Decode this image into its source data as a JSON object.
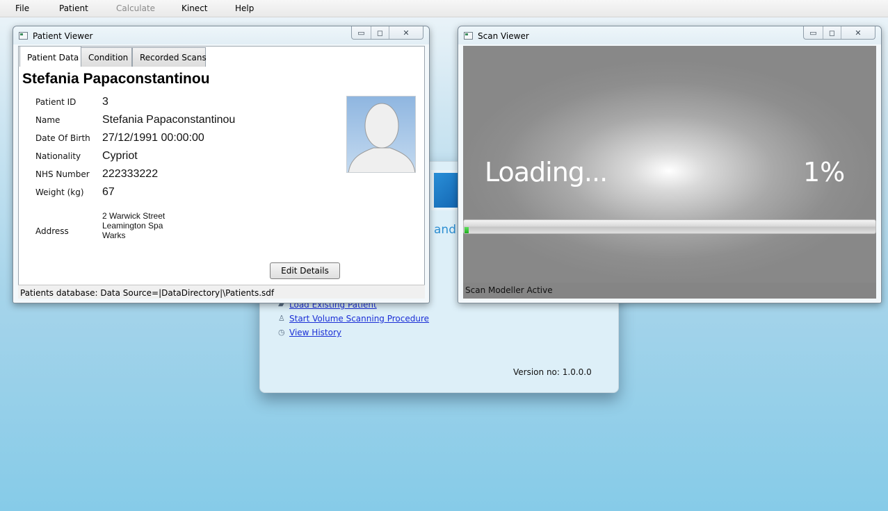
{
  "menubar": {
    "items": [
      "File",
      "Patient",
      "Calculate",
      "Kinect",
      "Help"
    ]
  },
  "start_window": {
    "logo_text": "and",
    "links": [
      {
        "label": "Load Existing Patient",
        "icon": "folder-icon"
      },
      {
        "label": "Start Volume Scanning Procedure",
        "icon": "person-icon"
      },
      {
        "label": "View History",
        "icon": "history-icon"
      }
    ],
    "version": "Version no: 1.0.0.0"
  },
  "patient_viewer": {
    "title": "Patient Viewer",
    "caption_buttons": {
      "minimize": "▭",
      "maximize": "◻",
      "close": "✕"
    },
    "tabs": [
      "Patient Data",
      "Condition",
      "Recorded Scans"
    ],
    "active_tab": "Patient Data",
    "patient_name": "Stefania Papaconstantinou",
    "fields": [
      {
        "label": "Patient ID",
        "value": "3"
      },
      {
        "label": "Name",
        "value": "Stefania Papaconstantinou"
      },
      {
        "label": "Date Of Birth",
        "value": "27/12/1991 00:00:00"
      },
      {
        "label": "Nationality",
        "value": "Cypriot"
      },
      {
        "label": "NHS Number",
        "value": "222333222"
      },
      {
        "label": "Weight (kg)",
        "value": "67"
      }
    ],
    "address": {
      "label": "Address",
      "lines": [
        "2 Warwick Street",
        "Leamington Spa",
        "Warks"
      ]
    },
    "edit_button": "Edit Details",
    "status": "Patients database: Data Source=|DataDirectory|\\Patients.sdf"
  },
  "scan_viewer": {
    "title": "Scan Viewer",
    "caption_buttons": {
      "minimize": "▭",
      "maximize": "◻",
      "close": "✕"
    },
    "loading_text": "Loading...",
    "percent_text": "1%",
    "progress_fraction": 0.01,
    "status": "Scan Modeller Active"
  },
  "colors": {
    "progress_fill": "#1fae1f",
    "link": "#1a2ed6",
    "desktop_bottom": "#86cbe8"
  }
}
